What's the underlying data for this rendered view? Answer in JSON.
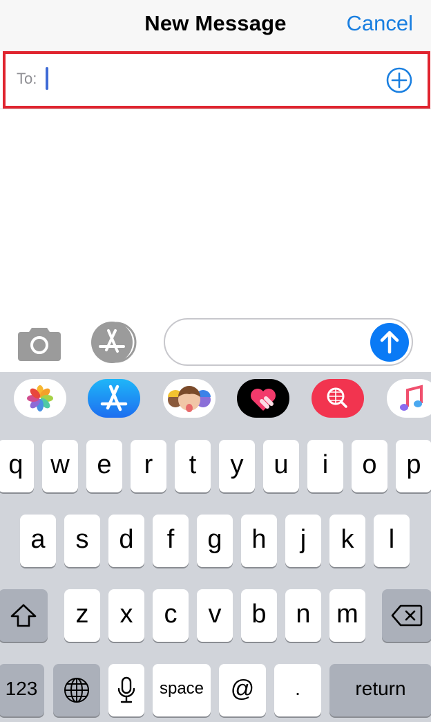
{
  "header": {
    "title": "New Message",
    "cancel_label": "Cancel"
  },
  "recipient": {
    "label": "To:",
    "value": "",
    "placeholder": "",
    "add_contact_icon": "plus-circle-icon",
    "highlight_color": "#e0242f"
  },
  "compose": {
    "camera_icon": "camera-icon",
    "apps_icon": "app-store-icon",
    "message_value": "",
    "message_placeholder": "",
    "send_icon": "arrow-up-icon"
  },
  "app_drawer": {
    "apps": [
      {
        "name": "Photos",
        "icon": "photos-icon"
      },
      {
        "name": "App Store",
        "icon": "app-store-icon"
      },
      {
        "name": "Memoji Stickers",
        "icon": "memoji-icon"
      },
      {
        "name": "Digital Touch",
        "icon": "heart-touch-icon"
      },
      {
        "name": "Images Search",
        "icon": "globe-search-icon"
      },
      {
        "name": "Music",
        "icon": "music-note-icon"
      }
    ]
  },
  "keyboard": {
    "row1": [
      "q",
      "w",
      "e",
      "r",
      "t",
      "y",
      "u",
      "i",
      "o",
      "p"
    ],
    "row2": [
      "a",
      "s",
      "d",
      "f",
      "g",
      "h",
      "j",
      "k",
      "l"
    ],
    "row3": [
      "z",
      "x",
      "c",
      "v",
      "b",
      "n",
      "m"
    ],
    "shift_icon": "shift-icon",
    "delete_icon": "delete-icon",
    "numbers_label": "123",
    "globe_icon": "globe-icon",
    "mic_icon": "microphone-icon",
    "space_label": "space",
    "at_label": "@",
    "period_label": ".",
    "return_label": "return"
  },
  "colors": {
    "accent": "#1a7fe0",
    "send_button": "#0a7af5",
    "keyboard_bg": "#d1d4da",
    "special_key": "#abb0ba"
  }
}
